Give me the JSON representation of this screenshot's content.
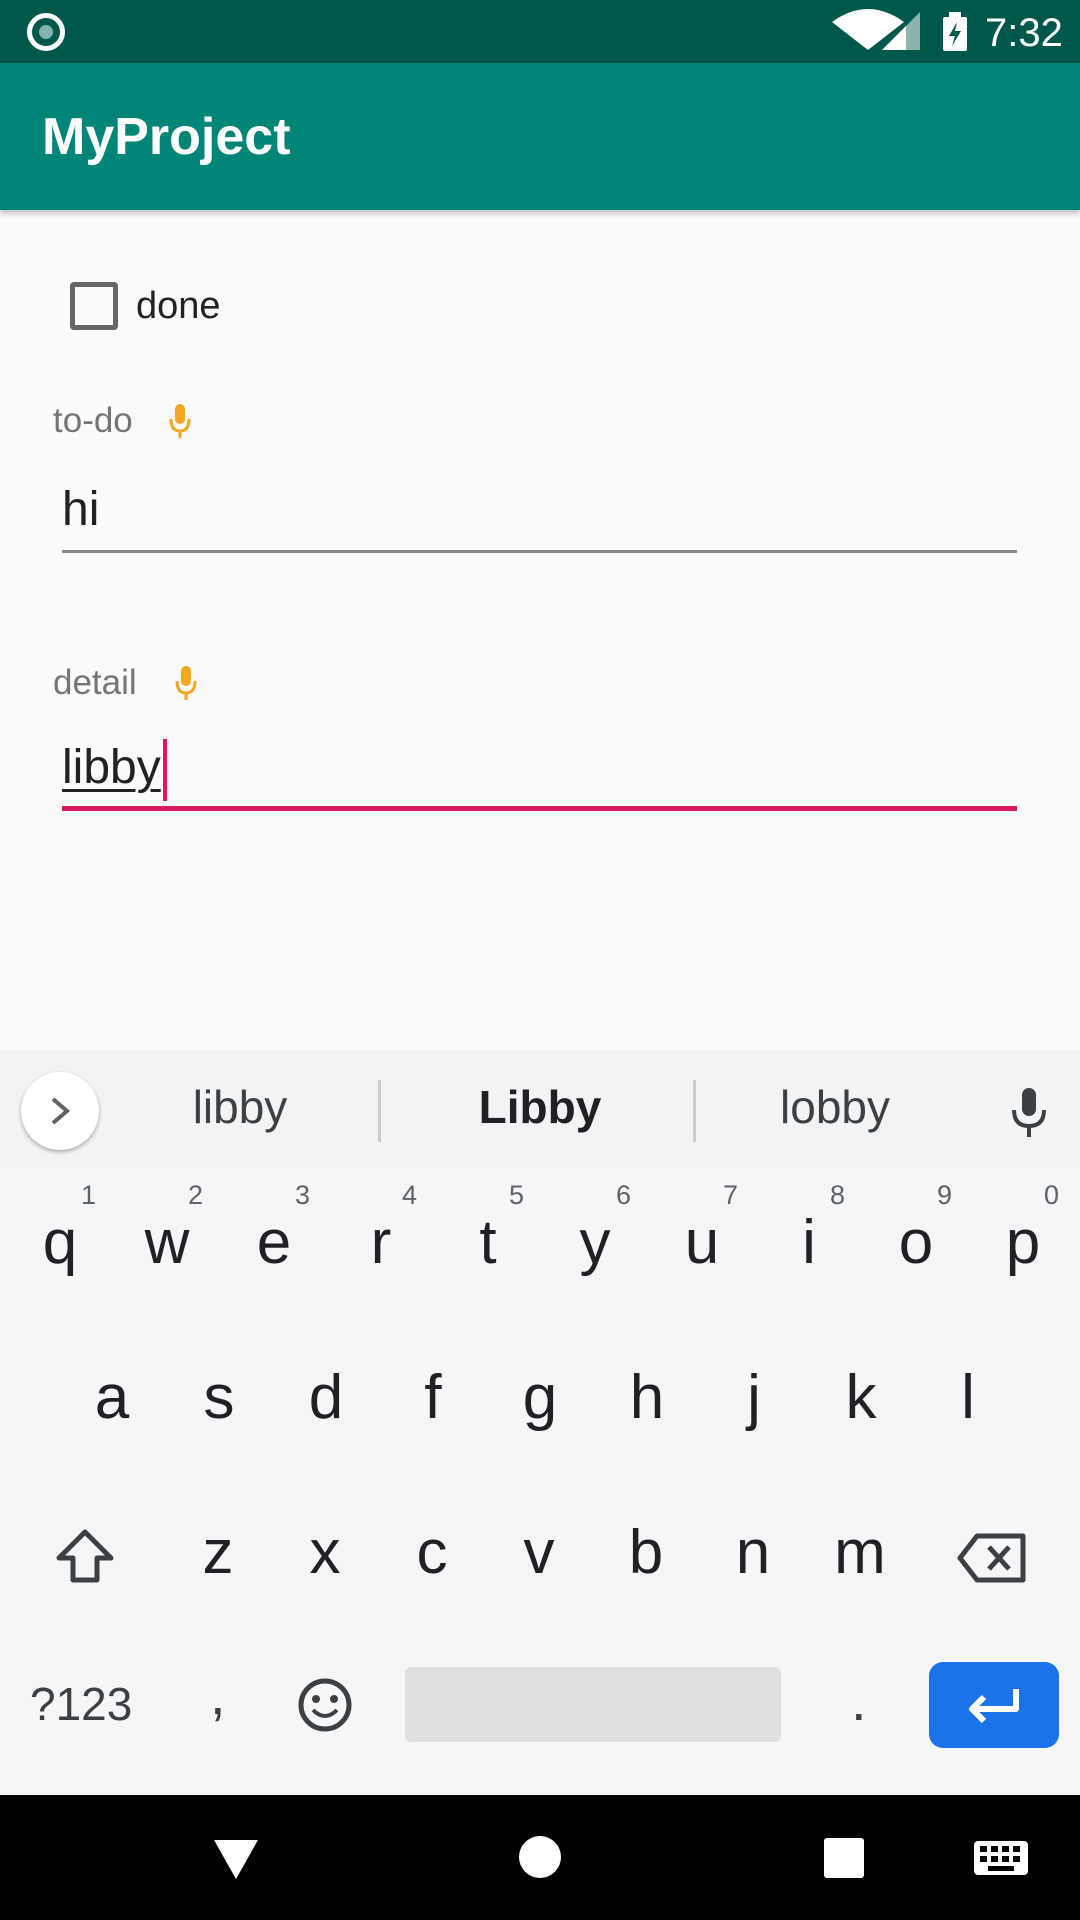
{
  "status_bar": {
    "time": "7:32"
  },
  "app_bar": {
    "title": "MyProject"
  },
  "form": {
    "checkbox_label": "done",
    "todo_label": "to-do",
    "todo_value": "hi",
    "detail_label": "detail",
    "detail_value": "libby"
  },
  "keyboard": {
    "suggestions": [
      "libby",
      "Libby",
      "lobby"
    ],
    "row1": [
      {
        "c": "q",
        "h": "1"
      },
      {
        "c": "w",
        "h": "2"
      },
      {
        "c": "e",
        "h": "3"
      },
      {
        "c": "r",
        "h": "4"
      },
      {
        "c": "t",
        "h": "5"
      },
      {
        "c": "y",
        "h": "6"
      },
      {
        "c": "u",
        "h": "7"
      },
      {
        "c": "i",
        "h": "8"
      },
      {
        "c": "o",
        "h": "9"
      },
      {
        "c": "p",
        "h": "0"
      }
    ],
    "row2": [
      "a",
      "s",
      "d",
      "f",
      "g",
      "h",
      "j",
      "k",
      "l"
    ],
    "row3": [
      "z",
      "x",
      "c",
      "v",
      "b",
      "n",
      "m"
    ],
    "symbols_label": "?123",
    "comma": ",",
    "period": "."
  },
  "icons": {
    "status_left": "app-status-icon",
    "wifi": "wifi-icon",
    "signal": "signal-icon",
    "battery": "battery-charging-icon",
    "mic": "mic-icon",
    "expand": "chevron-right-icon",
    "shift": "shift-icon",
    "backspace": "backspace-icon",
    "emoji": "emoji-icon",
    "enter": "enter-icon",
    "nav_back": "back-triangle-icon",
    "nav_home": "home-circle-icon",
    "nav_recents": "recents-square-icon",
    "nav_keyboard": "keyboard-icon"
  },
  "colors": {
    "status_bar": "#00574b",
    "app_bar": "#008577",
    "accent": "#d81b60",
    "mic": "#f5a623",
    "enter_key": "#1a73e8"
  }
}
